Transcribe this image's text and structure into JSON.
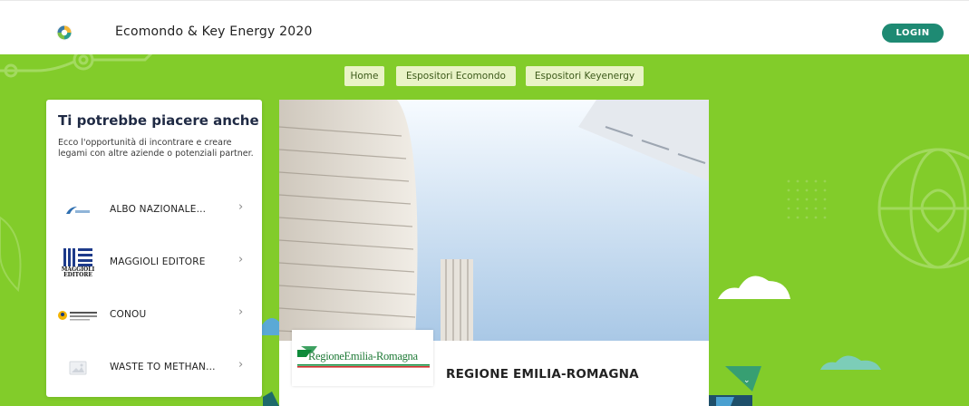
{
  "header": {
    "app_title": "Ecomondo & Key Energy 2020",
    "login_label": "LOGIN"
  },
  "nav": {
    "tabs": [
      {
        "label": "Home"
      },
      {
        "label": "Espositori Ecomondo"
      },
      {
        "label": "Espositori Keyenergy"
      }
    ]
  },
  "recommendations": {
    "title": "Ti potrebbe piacere anche",
    "description": "Ecco l'opportunità di incontrare e creare legami con altre aziende o potenziali partner.",
    "items": [
      {
        "name": "ALBO NAZIONALE..."
      },
      {
        "name": "MAGGIOLI EDITORE",
        "logo_text_1": "MAGGIOLI",
        "logo_text_2": "EDITORE"
      },
      {
        "name": "CONOU"
      },
      {
        "name": "WASTE TO METHAN..."
      }
    ]
  },
  "exhibitor": {
    "logo_text": "RegioneEmilia-Romagna",
    "name": "REGIONE EMILIA-ROMAGNA"
  },
  "colors": {
    "hero_green": "#82cc2a",
    "login_button": "#1e8a73",
    "nav_tab_bg": "#e9f3c7",
    "title_navy": "#1f2a44"
  },
  "icons": {
    "scroll_hint": "chevron-down-icon",
    "item_chevron": "chevron-right-icon",
    "placeholder_logo": "image-placeholder-icon"
  }
}
